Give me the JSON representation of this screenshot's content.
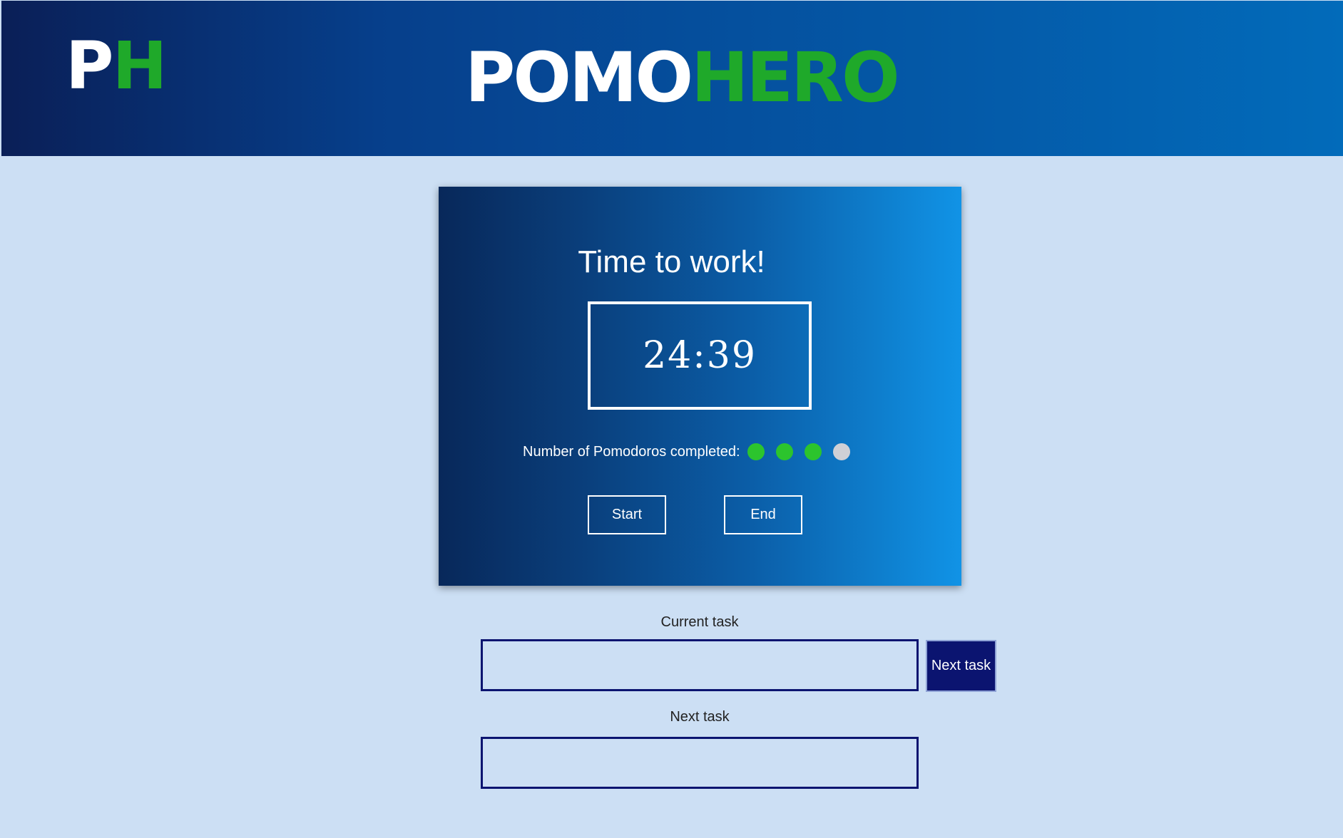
{
  "header": {
    "logo_first": "P",
    "logo_second": "H",
    "brand_first": "POMO",
    "brand_second": "HERO"
  },
  "timer_card": {
    "title": "Time to work!",
    "time": "24:39",
    "pomodoros_label": "Number of Pomodoros completed:",
    "pomodoros_completed": 3,
    "pomodoros_total": 4,
    "start_label": "Start",
    "end_label": "End"
  },
  "tasks": {
    "current_label": "Current task",
    "current_value": "",
    "next_button_label": "Next task",
    "next_label": "Next task",
    "next_value": ""
  },
  "colors": {
    "accent_green": "#1fa92a",
    "dot_complete": "#2cc42d",
    "dot_incomplete": "#cfd0d6",
    "navy": "#0b1470"
  }
}
